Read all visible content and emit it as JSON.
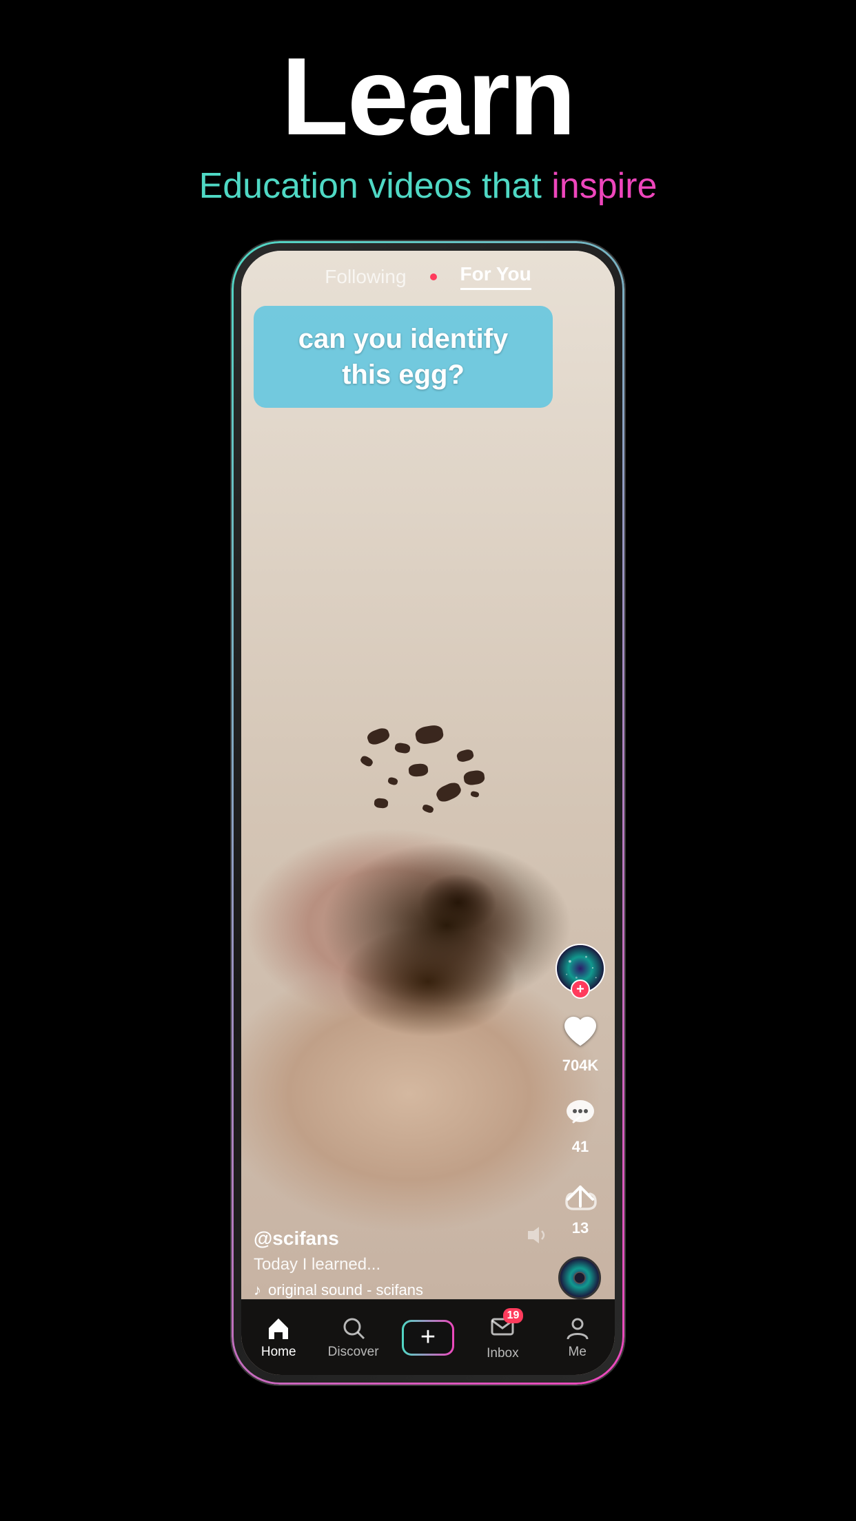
{
  "page": {
    "title": "Learn",
    "subtitle_plain": "Education videos that ",
    "subtitle_highlight": "inspire",
    "background_color": "#000"
  },
  "phone": {
    "nav": {
      "following_label": "Following",
      "for_you_label": "For You",
      "active_tab": "for_you"
    },
    "video": {
      "caption": "can you identify this egg?",
      "username": "@scifans",
      "description": "Today I learned...",
      "music": "original sound - scifans"
    },
    "actions": {
      "likes": "704K",
      "comments": "41",
      "shares": "13"
    },
    "bottom_nav": {
      "home_label": "Home",
      "discover_label": "Discover",
      "inbox_label": "Inbox",
      "me_label": "Me",
      "inbox_badge": "19"
    }
  }
}
